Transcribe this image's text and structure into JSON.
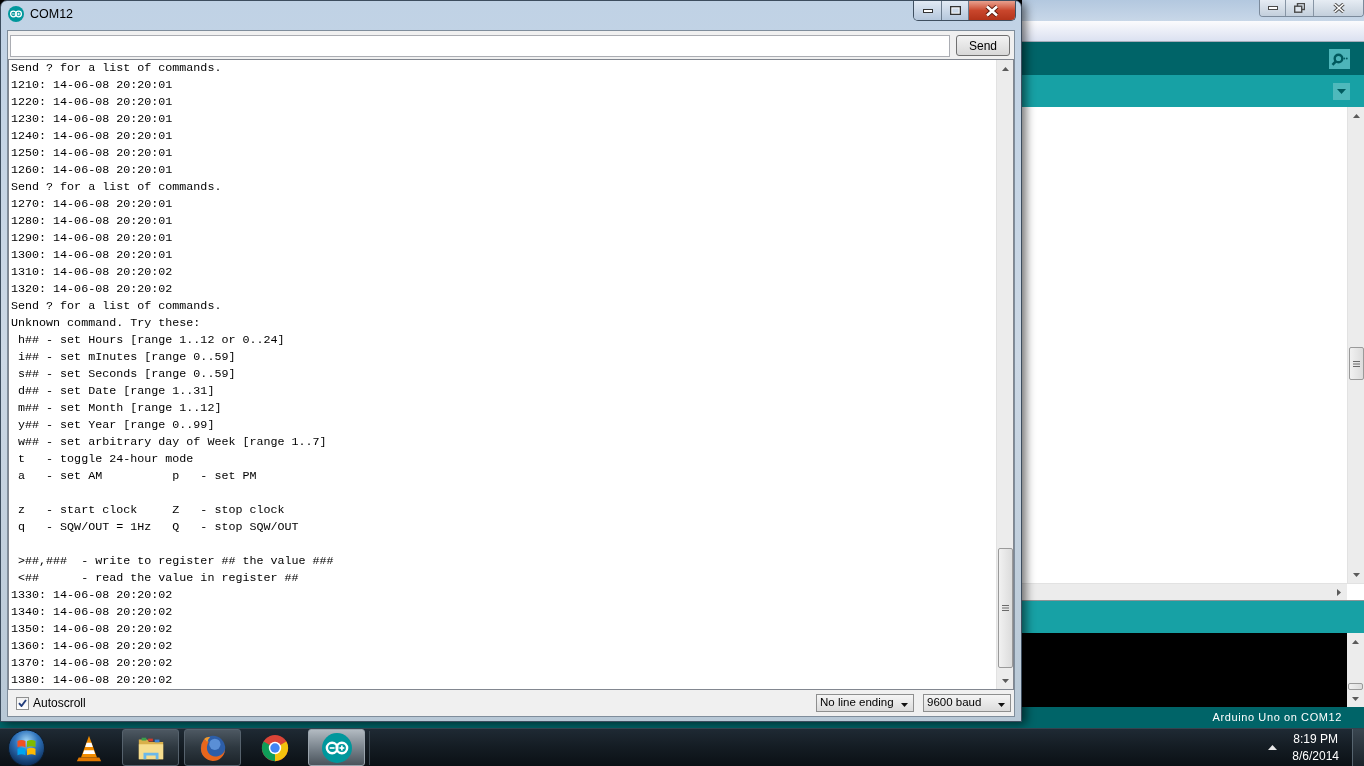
{
  "serial_monitor": {
    "title": "COM12",
    "send_button": "Send",
    "output": [
      {
        "kind": "line",
        "text": "Send ? for a list of commands."
      },
      {
        "kind": "line",
        "text": "1210: 14-06-08 20:20:01"
      },
      {
        "kind": "line",
        "text": "1220: 14-06-08 20:20:01"
      },
      {
        "kind": "line",
        "text": "1230: 14-06-08 20:20:01"
      },
      {
        "kind": "line",
        "text": "1240: 14-06-08 20:20:01"
      },
      {
        "kind": "line",
        "text": "1250: 14-06-08 20:20:01"
      },
      {
        "kind": "line",
        "text": "1260: 14-06-08 20:20:01"
      },
      {
        "kind": "line",
        "text": "Send ? for a list of commands."
      },
      {
        "kind": "line",
        "text": "1270: 14-06-08 20:20:01"
      },
      {
        "kind": "line",
        "text": "1280: 14-06-08 20:20:01"
      },
      {
        "kind": "line",
        "text": "1290: 14-06-08 20:20:01"
      },
      {
        "kind": "line",
        "text": "1300: 14-06-08 20:20:01"
      },
      {
        "kind": "line",
        "text": "1310: 14-06-08 20:20:02"
      },
      {
        "kind": "line",
        "text": "1320: 14-06-08 20:20:02"
      },
      {
        "kind": "line",
        "text": "Send ? for a list of commands."
      },
      {
        "kind": "line",
        "text": "Unknown command. Try these:"
      },
      {
        "kind": "line",
        "text": " h## - set Hours [range 1..12 or 0..24]"
      },
      {
        "kind": "line",
        "text": " i## - set mInutes [range 0..59]"
      },
      {
        "kind": "line",
        "text": " s## - set Seconds [range 0..59]"
      },
      {
        "kind": "line",
        "text": " d## - set Date [range 1..31]"
      },
      {
        "kind": "line",
        "text": " m## - set Month [range 1..12]"
      },
      {
        "kind": "line",
        "text": " y## - set Year [range 0..99]"
      },
      {
        "kind": "line",
        "text": " w## - set arbitrary day of Week [range 1..7]"
      },
      {
        "kind": "line",
        "text": " t   - toggle 24-hour mode"
      },
      {
        "kind": "line",
        "text": " a   - set AM          p   - set PM"
      },
      {
        "kind": "blank"
      },
      {
        "kind": "line",
        "text": " z   - start clock     Z   - stop clock"
      },
      {
        "kind": "line",
        "text": " q   - SQW/OUT = 1Hz   Q   - stop SQW/OUT"
      },
      {
        "kind": "blank"
      },
      {
        "kind": "line",
        "text": " >##,###  - write to register ## the value ###"
      },
      {
        "kind": "line",
        "text": " <##      - read the value in register ##"
      },
      {
        "kind": "line",
        "text": "1330: 14-06-08 20:20:02"
      },
      {
        "kind": "line",
        "text": "1340: 14-06-08 20:20:02"
      },
      {
        "kind": "line",
        "text": "1350: 14-06-08 20:20:02"
      },
      {
        "kind": "line",
        "text": "1360: 14-06-08 20:20:02"
      },
      {
        "kind": "line",
        "text": "1370: 14-06-08 20:20:02"
      },
      {
        "kind": "line",
        "text": "1380: 14-06-08 20:20:02"
      }
    ],
    "autoscroll": {
      "label": "Autoscroll",
      "checked": true
    },
    "line_ending": "No line ending",
    "baud_rate": "9600 baud"
  },
  "ide_window": {
    "status": "Arduino Uno on COM12"
  },
  "taskbar": {
    "apps": [
      {
        "kind": "cone",
        "running": false,
        "selected": false
      },
      {
        "kind": "folder",
        "running": true,
        "selected": false
      },
      {
        "kind": "globe",
        "running": true,
        "selected": false
      },
      {
        "kind": "wheel",
        "running": false,
        "selected": false
      },
      {
        "kind": "loops",
        "running": true,
        "selected": true
      }
    ],
    "clock": {
      "time": "8:19 PM",
      "date": "8/6/2014"
    }
  }
}
